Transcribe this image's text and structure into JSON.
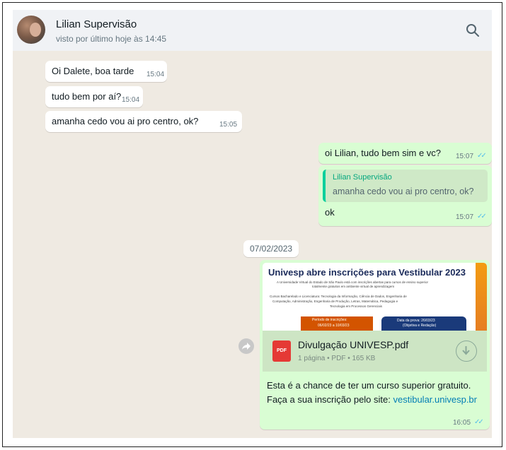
{
  "header": {
    "contact_name": "Lilian Supervisão",
    "status": "visto por último hoje às 14:45"
  },
  "messages_in": [
    {
      "text": "Oi Dalete, boa tarde",
      "time": "15:04"
    },
    {
      "text": "tudo bem por aí?",
      "time": "15:04"
    },
    {
      "text": "amanha cedo vou ai pro centro, ok?",
      "time": "15:05"
    }
  ],
  "out_1": {
    "text": "oi Lilian, tudo bem sim e vc?",
    "time": "15:07"
  },
  "out_reply": {
    "quote_author": "Lilian Supervisão",
    "quote_text": "amanha cedo vou ai pro centro, ok?",
    "text": "ok",
    "time": "15:07"
  },
  "date_divider": "07/02/2023",
  "media_message": {
    "banner_title": "Univesp abre inscrições para Vestibular 2023",
    "banner_line_1": "A Universidade Virtual do Estado de São Paulo está com inscrições abertas para cursos de ensino superior",
    "banner_line_2": "totalmente gratuitos em ambiente virtual de aprendizagem",
    "banner_line_3": "Cursos Bacharelado e Licenciatura: Tecnologia da Informação, Ciência de Dados, Engenharia de",
    "banner_line_4": "Computação, Administração, Engenharia de Produção, Letras, Matemática, Pedagogia e",
    "banner_line_5": "Tecnologia em Processos Gerenciais",
    "banner_box_a_title": "Período de inscrições:",
    "banner_box_a_value": "06/02/23 a 10/03/23",
    "banner_box_b_title": "Data da prova: 26/03/23",
    "banner_box_b_value": "(Objetiva e Redação)",
    "pdf_label": "PDF",
    "file_name": "Divulgação UNIVESP.pdf",
    "file_meta": "1 página • PDF • 165 KB",
    "caption_line_1": "Esta é a chance de ter um curso superior gratuito.",
    "caption_line_2_prefix": "Faça a sua inscrição pelo site: ",
    "caption_link": "vestibular.univesp.br",
    "time": "16:05"
  },
  "colors": {
    "chat_bg": "#efeae2",
    "incoming_bubble": "#ffffff",
    "outgoing_bubble": "#d9fdd3",
    "read_ticks": "#53bdeb",
    "link": "#027eb5"
  }
}
